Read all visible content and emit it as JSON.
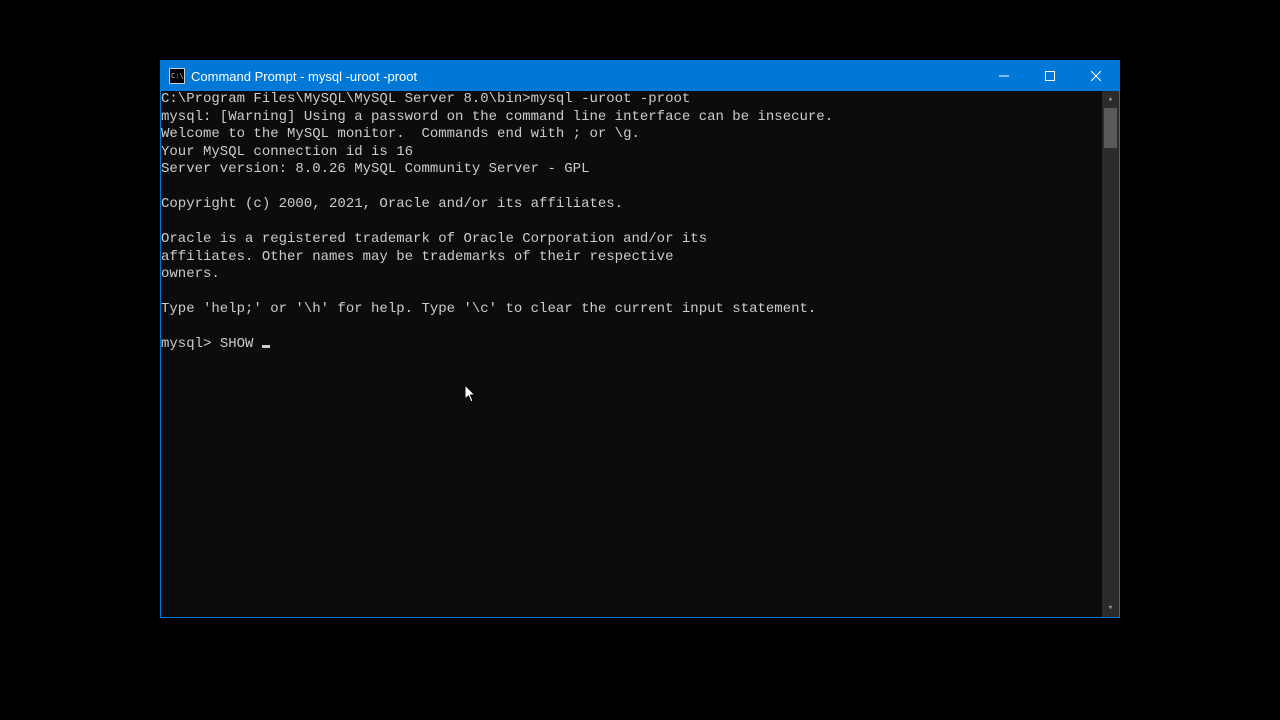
{
  "window": {
    "title": "Command Prompt - mysql  -uroot -proot",
    "icon_text": "C:\\"
  },
  "terminal": {
    "lines": [
      "C:\\Program Files\\MySQL\\MySQL Server 8.0\\bin>mysql -uroot -proot",
      "mysql: [Warning] Using a password on the command line interface can be insecure.",
      "Welcome to the MySQL monitor.  Commands end with ; or \\g.",
      "Your MySQL connection id is 16",
      "Server version: 8.0.26 MySQL Community Server - GPL",
      "",
      "Copyright (c) 2000, 2021, Oracle and/or its affiliates.",
      "",
      "Oracle is a registered trademark of Oracle Corporation and/or its",
      "affiliates. Other names may be trademarks of their respective",
      "owners.",
      "",
      "Type 'help;' or '\\h' for help. Type '\\c' to clear the current input statement.",
      ""
    ],
    "prompt": "mysql> ",
    "input": "SHOW "
  }
}
